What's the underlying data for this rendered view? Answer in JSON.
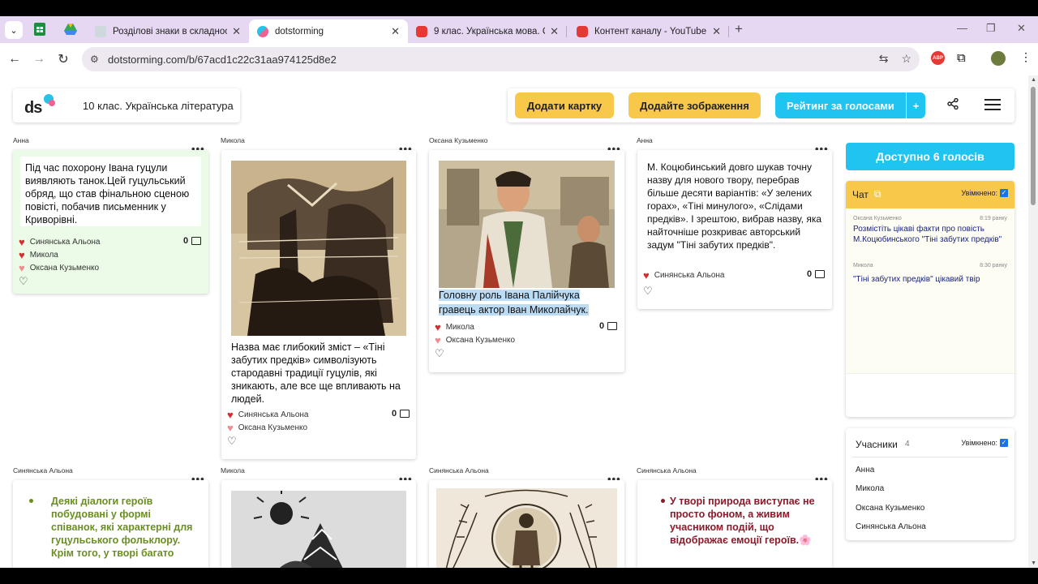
{
  "browser": {
    "tabs": [
      {
        "label": "Розділові знаки в складносурядн"
      },
      {
        "label": "dotstorming"
      },
      {
        "label": "9 клас. Українська мова. Склад"
      },
      {
        "label": "Контент каналу - YouTube Studio"
      }
    ],
    "url": "dotstorming.com/b/67acd1c22c31aa974125d8e2"
  },
  "board": {
    "logo_text": "ds",
    "title": "10 клас. Українська література"
  },
  "actions": {
    "add_card": "Додати картку",
    "add_image": "Додайте зображення",
    "rating": "Рейтинг за голосами",
    "plus": "+"
  },
  "cards": [
    {
      "author": "Анна",
      "text": "Під час похорону Івана гуцули виявляють танок.Цей гуцульський обряд, що став фінальною сценою повісті, побачив письменник у Криворівні.",
      "likes": [
        "Синянська Альона",
        "Микола",
        "Оксана Кузьменко"
      ],
      "comments": "0"
    },
    {
      "author": "Микола",
      "text": "Назва має глибокий зміст – «Тіні забутих предків» символізують стародавні традиції гуцулів, які зникають, але все ще впливають на людей.",
      "likes": [
        "Синянська Альона",
        "Оксана Кузьменко"
      ],
      "comments": "0"
    },
    {
      "author": "Оксана Кузьменко",
      "text": "Головну роль Івана Палійчука гравець актор Іван Миколайчук.",
      "likes": [
        "Микола",
        "Оксана Кузьменко"
      ],
      "comments": "0"
    },
    {
      "author": "Анна",
      "text": "М. Коцюбинський довго шукав точну назву для нового твору, перебрав більше десяти варіантів: «У зелених горах», «Тіні минулого», «Слідами предків». І зрештою, вибрав назву, яка найточніше розкриває авторський задум \"Тіні забутих предків\".",
      "likes": [
        "Синянська Альона"
      ],
      "comments": "0"
    },
    {
      "author": "Синянська Альона",
      "text": "Деякі діалоги героїв побудовані у формі співанок, які характерні для гуцульського фольклору. Крім того, у творі багато"
    },
    {
      "author": "Микола"
    },
    {
      "author": "Синянська Альона"
    },
    {
      "author": "Синянська Альона",
      "text": "У творі природа виступає не просто фоном, а живим учасником подій, що відображає емоції героїв.🌸"
    }
  ],
  "votes": "Доступно 6 голосів",
  "chat": {
    "title": "Чат",
    "toggle": "Увімкнено:",
    "messages": [
      {
        "author": "Оксана Кузьменко",
        "time": "8:19 ранку",
        "text": "Розмістіть цікаві факти про повість М.Коцюбинського \"Тіні забутих предків\""
      },
      {
        "author": "Микола",
        "time": "8:30 ранку",
        "text": "\"Тіні забутих предків\" цікавий твір"
      }
    ]
  },
  "members": {
    "title": "Учасники",
    "count": "4",
    "toggle": "Увімкнено:",
    "list": [
      "Анна",
      "Микола",
      "Оксана Кузьменко",
      "Синянська Альона"
    ]
  },
  "colors": {
    "yellow": "#f7c84a",
    "cyan": "#1fc4f0",
    "green_card": "#ebfbe8",
    "olive_text": "#6b8e23",
    "maroon_text": "#8b1a2b"
  }
}
